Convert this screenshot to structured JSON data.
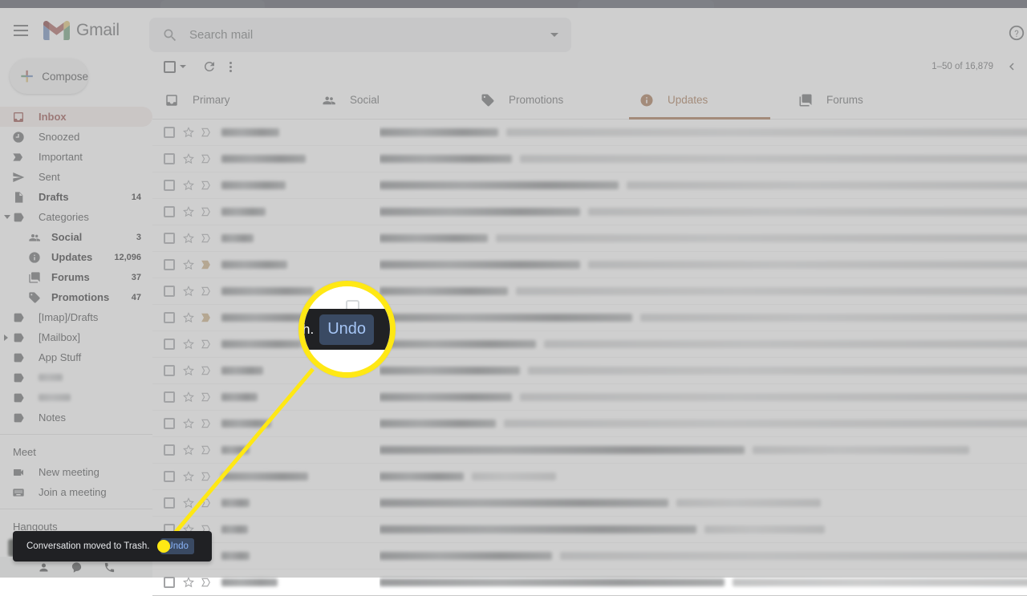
{
  "window": {
    "title": "Gmail"
  },
  "header": {
    "menu_icon": "hamburger-menu-icon",
    "logo_text": "Gmail",
    "search": {
      "icon": "search-icon",
      "placeholder": "Search mail",
      "value": "",
      "options_icon": "chevron-down-icon"
    },
    "help_icon": "help-circle-icon"
  },
  "sidebar": {
    "compose": {
      "label": "Compose",
      "icon": "plus-icon"
    },
    "items": [
      {
        "label": "Inbox",
        "icon": "inbox-icon",
        "count": "",
        "active": true,
        "bold": false,
        "sub": false
      },
      {
        "label": "Snoozed",
        "icon": "clock-icon",
        "count": "",
        "active": false,
        "bold": false,
        "sub": false
      },
      {
        "label": "Important",
        "icon": "important-marker-icon",
        "count": "",
        "active": false,
        "bold": false,
        "sub": false
      },
      {
        "label": "Sent",
        "icon": "send-icon",
        "count": "",
        "active": false,
        "bold": false,
        "sub": false
      },
      {
        "label": "Drafts",
        "icon": "draft-file-icon",
        "count": "14",
        "active": false,
        "bold": true,
        "sub": false
      },
      {
        "label": "Categories",
        "icon": "label-tag-icon",
        "count": "",
        "active": false,
        "bold": false,
        "sub": false,
        "expander": "down"
      },
      {
        "label": "Social",
        "icon": "people-icon",
        "count": "3",
        "active": false,
        "bold": true,
        "sub": true
      },
      {
        "label": "Updates",
        "icon": "info-circle-icon",
        "count": "12,096",
        "active": false,
        "bold": true,
        "sub": true
      },
      {
        "label": "Forums",
        "icon": "forum-icon",
        "count": "37",
        "active": false,
        "bold": true,
        "sub": true
      },
      {
        "label": "Promotions",
        "icon": "promo-tag-icon",
        "count": "47",
        "active": false,
        "bold": true,
        "sub": true
      },
      {
        "label": "[Imap]/Drafts",
        "icon": "label-tag-icon",
        "count": "",
        "active": false,
        "bold": false,
        "sub": false
      },
      {
        "label": "[Mailbox]",
        "icon": "label-tag-icon",
        "count": "",
        "active": false,
        "bold": false,
        "sub": false,
        "expander": "right"
      },
      {
        "label": "App Stuff",
        "icon": "label-tag-icon",
        "count": "",
        "active": false,
        "bold": false,
        "sub": false
      },
      {
        "label": "",
        "icon": "label-tag-icon",
        "count": "",
        "active": false,
        "bold": false,
        "sub": false,
        "redacted": 30
      },
      {
        "label": "",
        "icon": "label-tag-icon",
        "count": "",
        "active": false,
        "bold": false,
        "sub": false,
        "redacted": 40
      },
      {
        "label": "Notes",
        "icon": "label-tag-icon",
        "count": "",
        "active": false,
        "bold": false,
        "sub": false
      }
    ],
    "meet": {
      "title": "Meet",
      "items": [
        {
          "label": "New meeting",
          "icon": "video-camera-icon"
        },
        {
          "label": "Join a meeting",
          "icon": "keyboard-icon"
        }
      ]
    },
    "hangouts": {
      "title": "Hangouts",
      "status_caret_icon": "chevron-down-icon",
      "add_icon": "plus-icon"
    },
    "bottom_icons": [
      "contacts-person-icon",
      "chat-bubble-icon",
      "phone-icon"
    ]
  },
  "toolbar": {
    "select_all_icon": "checkbox-icon",
    "select_all_caret_icon": "chevron-down-icon",
    "refresh_icon": "refresh-icon",
    "more_icon": "more-vertical-icon",
    "pagination_text": "1–50 of 16,879",
    "prev_icon": "chevron-left-icon"
  },
  "tabs": [
    {
      "label": "Primary",
      "icon": "inbox-tab-icon",
      "active": false
    },
    {
      "label": "Social",
      "icon": "people-icon",
      "active": false
    },
    {
      "label": "Promotions",
      "icon": "promo-tag-icon",
      "active": false
    },
    {
      "label": "Updates",
      "icon": "info-circle-icon",
      "active": true
    },
    {
      "label": "Forums",
      "icon": "forum-icon",
      "active": false
    }
  ],
  "email_rows": [
    {
      "sender_w": 72,
      "important": false,
      "subject_w": 148,
      "snippet_w": 700
    },
    {
      "sender_w": 105,
      "important": false,
      "subject_w": 165,
      "snippet_w": 680
    },
    {
      "sender_w": 80,
      "important": false,
      "subject_w": 298,
      "snippet_w": 560
    },
    {
      "sender_w": 55,
      "important": false,
      "subject_w": 250,
      "snippet_w": 600
    },
    {
      "sender_w": 40,
      "important": false,
      "subject_w": 135,
      "snippet_w": 700
    },
    {
      "sender_w": 82,
      "important": true,
      "subject_w": 250,
      "snippet_w": 600
    },
    {
      "sender_w": 115,
      "important": false,
      "subject_w": 160,
      "snippet_w": 690
    },
    {
      "sender_w": 120,
      "important": true,
      "subject_w": 315,
      "snippet_w": 540
    },
    {
      "sender_w": 100,
      "important": false,
      "subject_w": 195,
      "snippet_w": 655
    },
    {
      "sender_w": 52,
      "important": false,
      "subject_w": 175,
      "snippet_w": 670
    },
    {
      "sender_w": 45,
      "important": false,
      "subject_w": 165,
      "snippet_w": 680
    },
    {
      "sender_w": 62,
      "important": false,
      "subject_w": 145,
      "snippet_w": 700
    },
    {
      "sender_w": 35,
      "important": false,
      "subject_w": 455,
      "snippet_w": 270
    },
    {
      "sender_w": 108,
      "important": false,
      "subject_w": 105,
      "snippet_w": 105
    },
    {
      "sender_w": 35,
      "important": false,
      "subject_w": 360,
      "snippet_w": 180
    },
    {
      "sender_w": 33,
      "important": false,
      "subject_w": 395,
      "snippet_w": 150
    },
    {
      "sender_w": 35,
      "important": false,
      "subject_w": 215,
      "snippet_w": 620
    },
    {
      "sender_w": 70,
      "important": false,
      "subject_w": 430,
      "snippet_w": 400
    }
  ],
  "annotation": {
    "magnifier": {
      "snippet_text": "h.",
      "undo_label": "Undo",
      "ring_color": "#ffe814"
    },
    "pointer_color": "#ffe814"
  },
  "snackbar": {
    "message": "Conversation moved to Trash.",
    "undo_label": "Undo",
    "close_icon": "close-x-icon"
  }
}
